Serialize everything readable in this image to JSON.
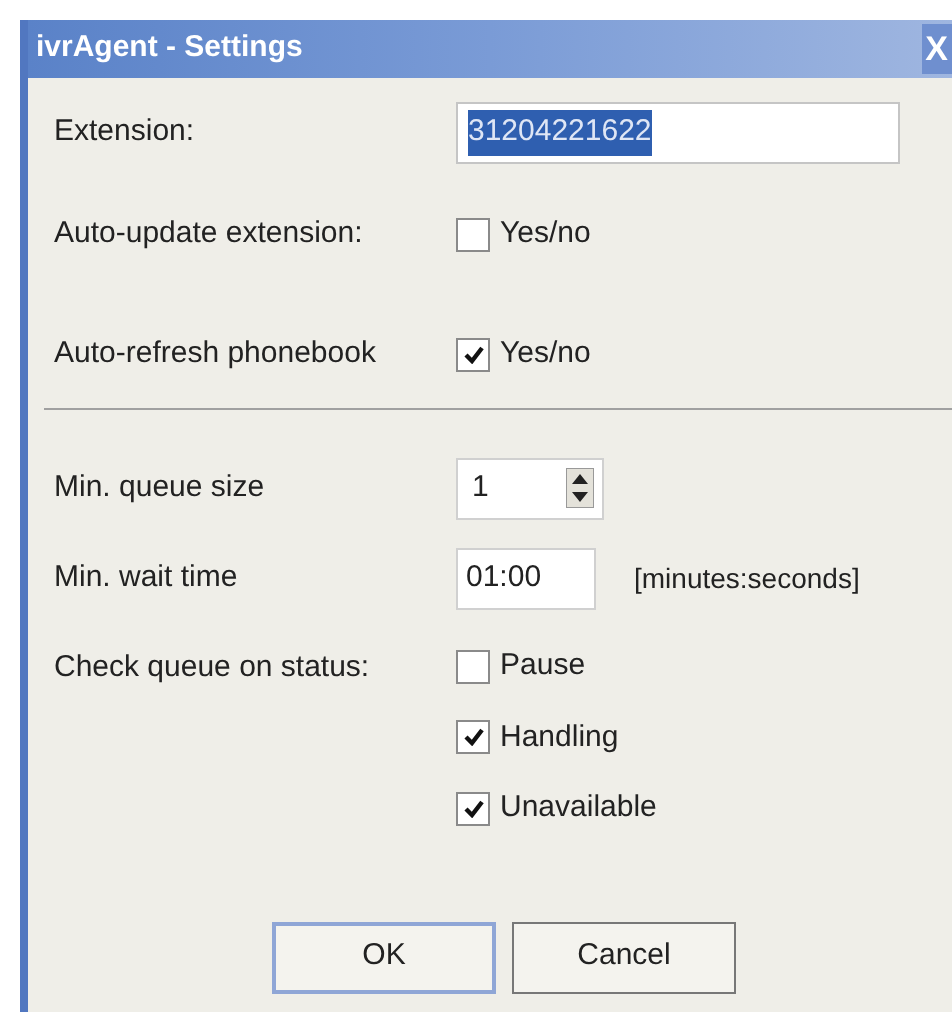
{
  "window": {
    "title": "ivrAgent - Settings",
    "close": "X"
  },
  "extension": {
    "label": "Extension:",
    "value": "31204221622",
    "text_selected": true
  },
  "auto_update": {
    "label": "Auto-update extension:",
    "option": "Yes/no",
    "checked": false
  },
  "auto_refresh": {
    "label": "Auto-refresh phonebook",
    "option": "Yes/no",
    "checked": true
  },
  "min_queue_size": {
    "label": "Min. queue size",
    "value": "1"
  },
  "min_wait_time": {
    "label": "Min. wait time",
    "value": "01:00",
    "hint": "[minutes:seconds]"
  },
  "check_queue": {
    "label": "Check queue on status:",
    "options": [
      {
        "label": "Pause",
        "checked": false
      },
      {
        "label": "Handling",
        "checked": true
      },
      {
        "label": "Unavailable",
        "checked": true
      }
    ]
  },
  "buttons": [
    {
      "label": "OK",
      "default": true
    },
    {
      "label": "Cancel",
      "default": false
    }
  ]
}
